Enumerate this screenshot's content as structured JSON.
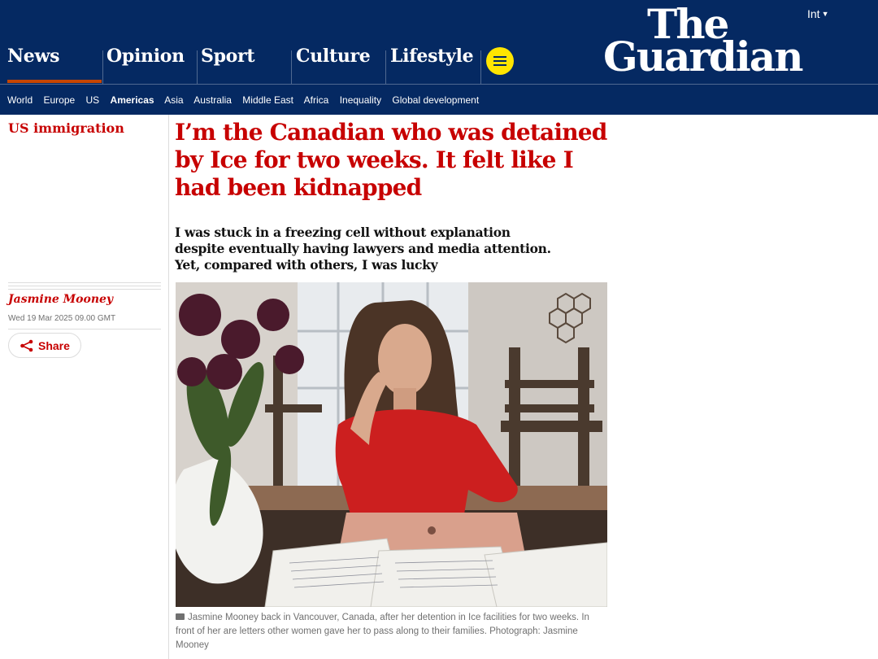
{
  "header": {
    "pillars": [
      "News",
      "Opinion",
      "Sport",
      "Culture",
      "Lifestyle"
    ],
    "edition": "Int",
    "logo_line1": "The",
    "logo_line2": "Guardian",
    "subnav": [
      "World",
      "Europe",
      "US",
      "Americas",
      "Asia",
      "Australia",
      "Middle East",
      "Africa",
      "Inequality",
      "Global development"
    ],
    "active_subnav": "Americas"
  },
  "article": {
    "section": "US immigration",
    "headline": "I’m the Canadian who was detained by Ice for two weeks. It felt like I had been kidnapped",
    "standfirst": "I was stuck in a freezing cell without explanation despite eventually having lawyers and media attention. Yet, compared with others, I was lucky",
    "byline": "Jasmine Mooney",
    "date": "Wed 19 Mar 2025 09.00 GMT",
    "share_label": "Share",
    "caption": "Jasmine Mooney back in Vancouver, Canada, after her detention in Ice facilities for two weeks. In front of her are letters other women gave her to pass along to their families. Photograph: Jasmine Mooney"
  },
  "colors": {
    "brand_blue": "#052962",
    "news_red": "#c70000",
    "menu_yellow": "#ffe500",
    "pillar_underline": "#c74600"
  },
  "icons": [
    "menu-icon",
    "chevron-down-icon",
    "share-icon",
    "camera-icon"
  ]
}
